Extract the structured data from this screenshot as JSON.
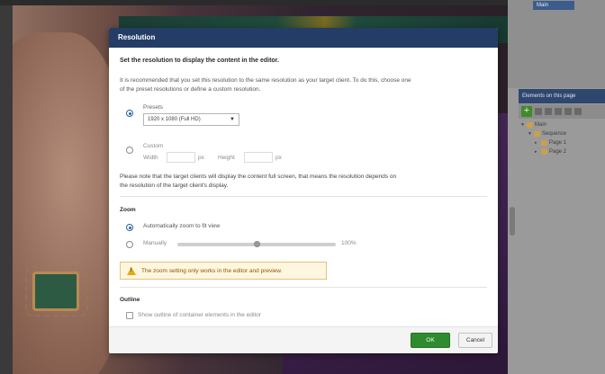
{
  "background": {
    "right_panel": {
      "top_item": "Main",
      "elements_header": "Elements on this page",
      "tree": [
        {
          "label": "Main",
          "level": 0
        },
        {
          "label": "Sequence",
          "level": 1
        },
        {
          "label": "Page 1",
          "level": 2
        },
        {
          "label": "Page 2",
          "level": 2
        }
      ]
    }
  },
  "dialog": {
    "title": "Resolution",
    "heading": "Set the resolution to display the content in the editor.",
    "intro_line1": "It is recommended that you set this resolution to the same resolution as your target client. To do this, choose one",
    "intro_line2": "of the preset resolutions or define a custom resolution.",
    "presets_label": "Presets",
    "presets_value": "1920 x 1080 (Full HD)",
    "custom_label": "Custom",
    "width_label": "Width",
    "width_unit": "px",
    "height_label": "Height",
    "height_unit": "px",
    "note_line1": "Please note that the target clients will display the content full screen, that means the resolution depends on",
    "note_line2": "the resolution of the target client's display.",
    "zoom_heading": "Zoom",
    "zoom_auto_label": "Automatically zoom to fit view",
    "zoom_manual_label": "Manually",
    "zoom_value_label": "100%",
    "zoom_slider_value": 0.5,
    "warning_text": "The zoom setting only works in the editor and preview.",
    "outline_heading": "Outline",
    "outline_checkbox_label": "Show outline of container elements in the editor",
    "ok_label": "OK",
    "cancel_label": "Cancel"
  },
  "colors": {
    "title_bar": "#233d66",
    "ok_button": "#2e8b2e",
    "accent_radio": "#2d5faa",
    "warning_bg": "#fff6e0"
  }
}
